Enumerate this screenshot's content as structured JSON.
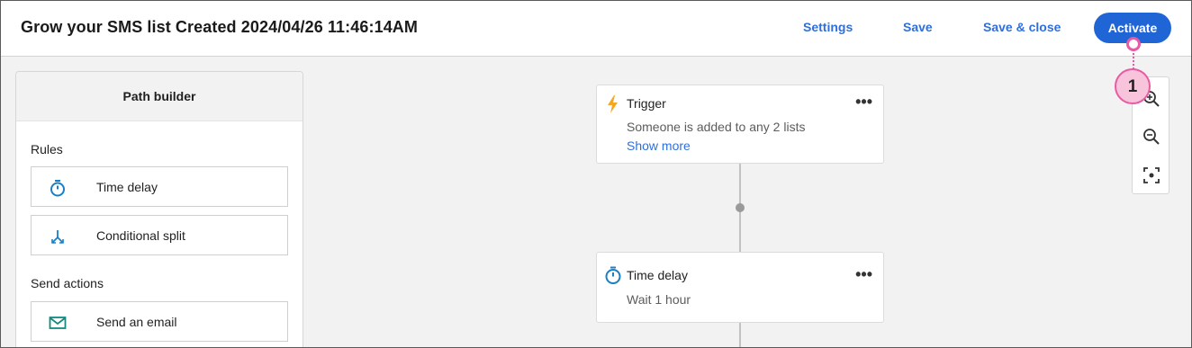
{
  "header": {
    "title": "Grow your SMS list Created 2024/04/26 11:46:14AM",
    "settings_label": "Settings",
    "save_label": "Save",
    "save_close_label": "Save & close",
    "activate_label": "Activate"
  },
  "path_builder": {
    "title": "Path builder",
    "rules_label": "Rules",
    "rules": [
      {
        "label": "Time delay",
        "icon": "stopwatch-icon"
      },
      {
        "label": "Conditional split",
        "icon": "split-arrows-icon"
      }
    ],
    "send_actions_label": "Send actions",
    "send_actions": [
      {
        "label": "Send an email",
        "icon": "envelope-icon"
      }
    ]
  },
  "canvas": {
    "trigger": {
      "title": "Trigger",
      "description": "Someone is added to any 2 lists",
      "show_more": "Show more",
      "icon": "lightning-icon",
      "menu": "•••"
    },
    "time_delay": {
      "title": "Time delay",
      "description": "Wait 1 hour",
      "icon": "stopwatch-icon",
      "menu": "•••"
    }
  },
  "zoom_controls": [
    "zoom-in-icon",
    "zoom-out-icon",
    "fit-to-screen-icon"
  ],
  "annotation": {
    "number": "1",
    "color": "#e85aa4"
  },
  "colors": {
    "accent": "#1f65d6",
    "link": "#2f6fdc",
    "trigger_icon": "#f5a623",
    "rule_icon": "#1a7fc4",
    "email_icon": "#138a7e"
  }
}
